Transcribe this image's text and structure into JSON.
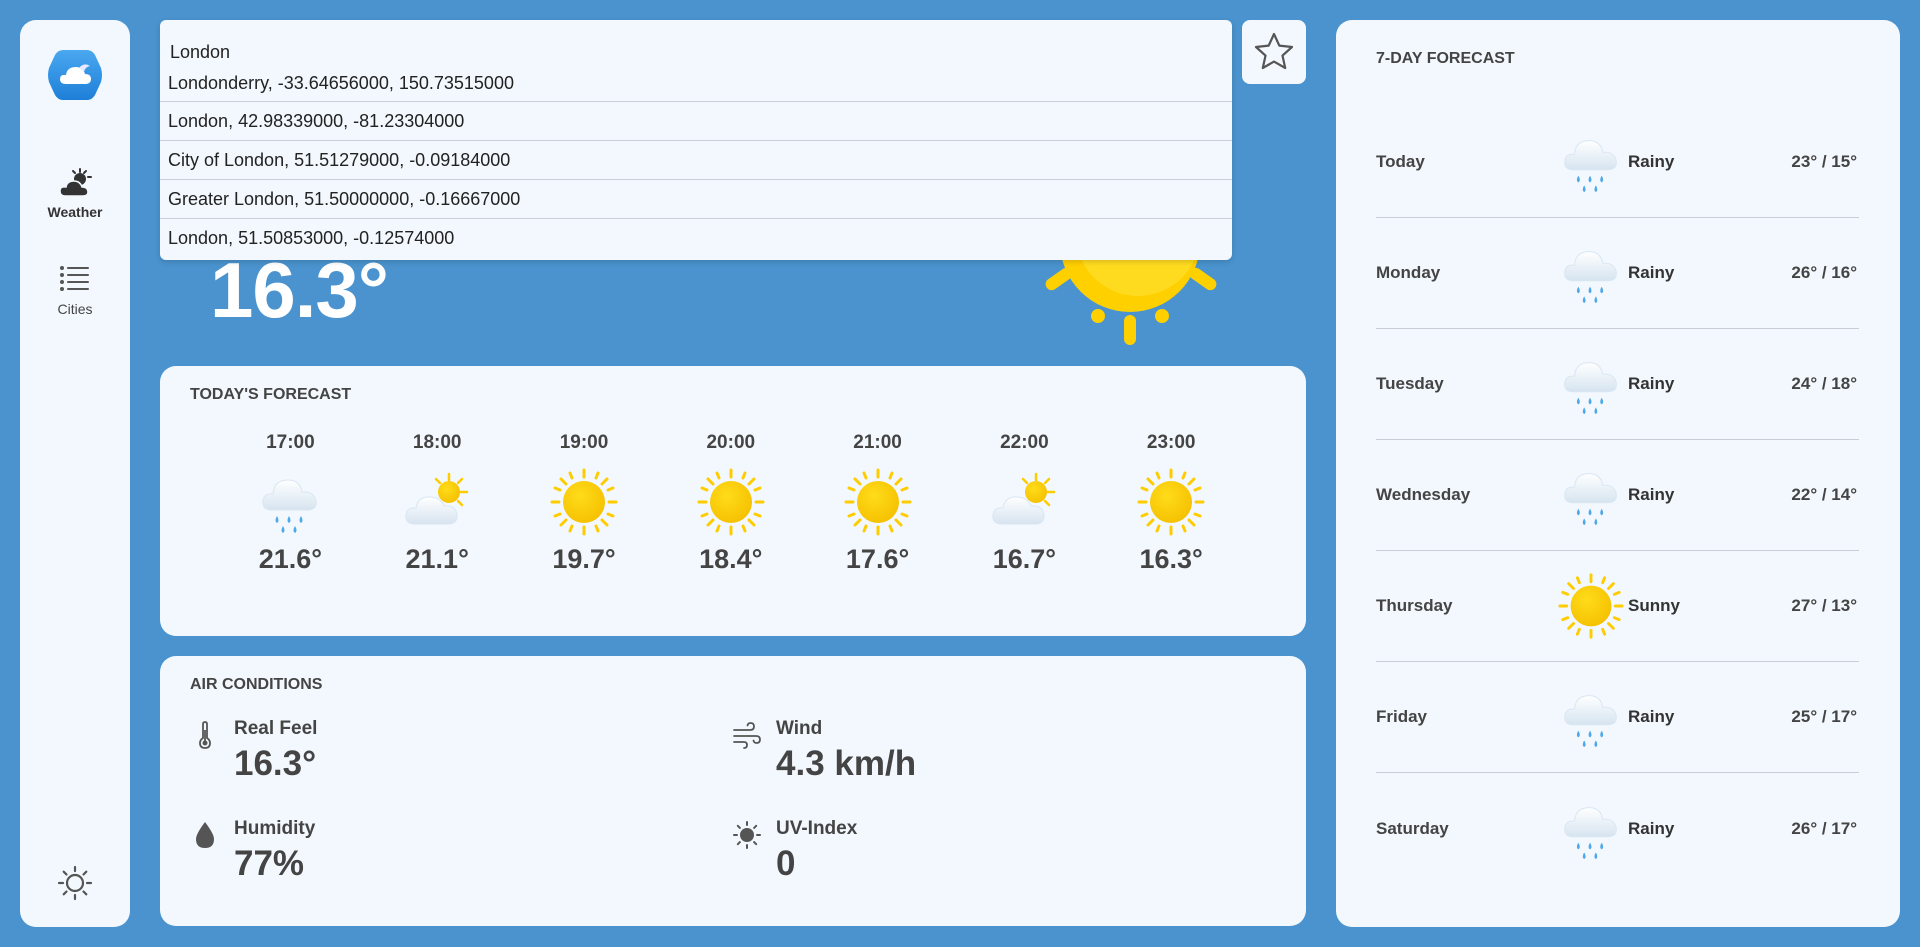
{
  "sidebar": {
    "items": [
      {
        "label": "Weather",
        "icon": "weather-icon"
      },
      {
        "label": "Cities",
        "icon": "list-icon"
      }
    ]
  },
  "search": {
    "value": "London",
    "suggestions": [
      "Londonderry, -33.64656000, 150.73515000",
      "London, 42.98339000, -81.23304000",
      "City of London, 51.51279000, -0.09184000",
      "Greater London, 51.50000000, -0.16667000",
      "London, 51.50853000, -0.12574000"
    ]
  },
  "current": {
    "temperature": "16.3°",
    "icon": "sunny-icon"
  },
  "today_forecast": {
    "title": "TODAY'S FORECAST",
    "hours": [
      {
        "time": "17:00",
        "temp": "21.6°",
        "icon": "rain-icon"
      },
      {
        "time": "18:00",
        "temp": "21.1°",
        "icon": "partly-cloudy-icon"
      },
      {
        "time": "19:00",
        "temp": "19.7°",
        "icon": "sunny-icon"
      },
      {
        "time": "20:00",
        "temp": "18.4°",
        "icon": "sunny-icon"
      },
      {
        "time": "21:00",
        "temp": "17.6°",
        "icon": "sunny-icon"
      },
      {
        "time": "22:00",
        "temp": "16.7°",
        "icon": "partly-cloudy-icon"
      },
      {
        "time": "23:00",
        "temp": "16.3°",
        "icon": "sunny-icon"
      }
    ]
  },
  "air_conditions": {
    "title": "AIR CONDITIONS",
    "real_feel": {
      "label": "Real Feel",
      "value": "16.3°"
    },
    "wind": {
      "label": "Wind",
      "value": "4.3 km/h"
    },
    "humidity": {
      "label": "Humidity",
      "value": "77%"
    },
    "uv": {
      "label": "UV-Index",
      "value": "0"
    }
  },
  "week_forecast": {
    "title": "7-DAY FORECAST",
    "days": [
      {
        "day": "Today",
        "condition": "Rainy",
        "temp": "23° / 15°",
        "icon": "rain-icon"
      },
      {
        "day": "Monday",
        "condition": "Rainy",
        "temp": "26° / 16°",
        "icon": "rain-icon"
      },
      {
        "day": "Tuesday",
        "condition": "Rainy",
        "temp": "24° / 18°",
        "icon": "rain-icon"
      },
      {
        "day": "Wednesday",
        "condition": "Rainy",
        "temp": "22° / 14°",
        "icon": "rain-icon"
      },
      {
        "day": "Thursday",
        "condition": "Sunny",
        "temp": "27° / 13°",
        "icon": "sunny-icon"
      },
      {
        "day": "Friday",
        "condition": "Rainy",
        "temp": "25° / 17°",
        "icon": "rain-icon"
      },
      {
        "day": "Saturday",
        "condition": "Rainy",
        "temp": "26° / 17°",
        "icon": "rain-icon"
      }
    ]
  },
  "colors": {
    "background": "#4a93ce",
    "panel": "#f2f8fd",
    "sun": "#ffd000",
    "rain_drop": "#4fa8e8"
  }
}
